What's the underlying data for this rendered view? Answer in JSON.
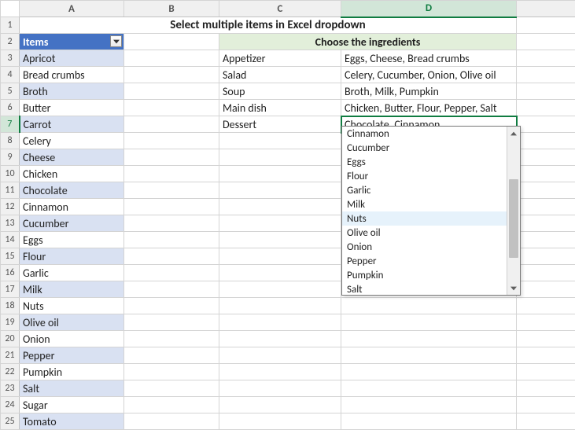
{
  "columns": [
    "A",
    "B",
    "C",
    "D"
  ],
  "title": "Select multiple items in Excel dropdown",
  "headers": {
    "items": "Items",
    "choose": "Choose the ingredients"
  },
  "items_list": [
    "Apricot",
    "Bread crumbs",
    "Broth",
    "Butter",
    "Carrot",
    "Celery",
    "Cheese",
    "Chicken",
    "Chocolate",
    "Cinnamon",
    "Cucumber",
    "Eggs",
    "Flour",
    "Garlic",
    "Milk",
    "Nuts",
    "Olive oil",
    "Onion",
    "Pepper",
    "Pumpkin",
    "Salt",
    "Sugar",
    "Tomato"
  ],
  "recipes": [
    {
      "course": "Appetizer",
      "ingredients": "Eggs, Cheese, Bread crumbs"
    },
    {
      "course": "Salad",
      "ingredients": "Celery, Cucumber, Onion, Olive oil"
    },
    {
      "course": "Soup",
      "ingredients": "Broth, Milk, Pumpkin"
    },
    {
      "course": "Main dish",
      "ingredients": "Chicken, Butter, Flour, Pepper, Salt"
    },
    {
      "course": "Dessert",
      "ingredients": "Chocolate, Cinnamon"
    }
  ],
  "dropdown": {
    "items": [
      "Cinnamon",
      "Cucumber",
      "Eggs",
      "Flour",
      "Garlic",
      "Milk",
      "Nuts",
      "Olive oil",
      "Onion",
      "Pepper",
      "Pumpkin",
      "Salt"
    ],
    "hover_index": 6
  },
  "selected_cell": {
    "row": 7,
    "col": "D"
  }
}
